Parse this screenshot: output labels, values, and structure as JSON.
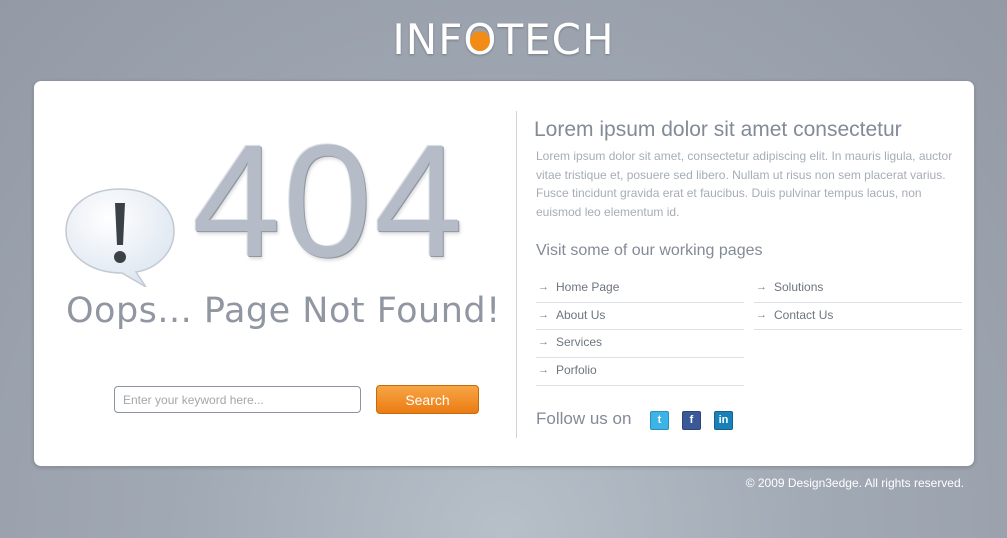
{
  "logo": {
    "text_before": "INF",
    "text_o": "O",
    "text_after": "TECH",
    "accent": "#f28c16"
  },
  "error": {
    "code": "404",
    "message": "Oops... Page Not Found!",
    "icon": "exclamation-speech-bubble-icon"
  },
  "search": {
    "placeholder": "Enter your keyword here...",
    "button_label": "Search"
  },
  "info": {
    "heading": "Lorem ipsum dolor sit amet consectetur",
    "paragraph": "Lorem ipsum dolor sit amet, consectetur adipiscing elit. In mauris ligula, auctor vitae tristique et, posuere sed libero. Nullam ut risus non sem placerat varius. Fusce tincidunt gravida erat et faucibus. Duis pulvinar tempus lacus, non euismod leo elementum id."
  },
  "working_pages": {
    "heading": "Visit some of our working pages",
    "col1": [
      "Home Page",
      "About Us",
      "Services",
      "Porfolio"
    ],
    "col2": [
      "Solutions",
      "Contact Us"
    ]
  },
  "follow": {
    "label": "Follow us on",
    "networks": [
      "twitter-icon",
      "facebook-icon",
      "linkedin-icon"
    ]
  },
  "footer": {
    "copyright": "© 2009 Design3edge. All rights reserved."
  }
}
